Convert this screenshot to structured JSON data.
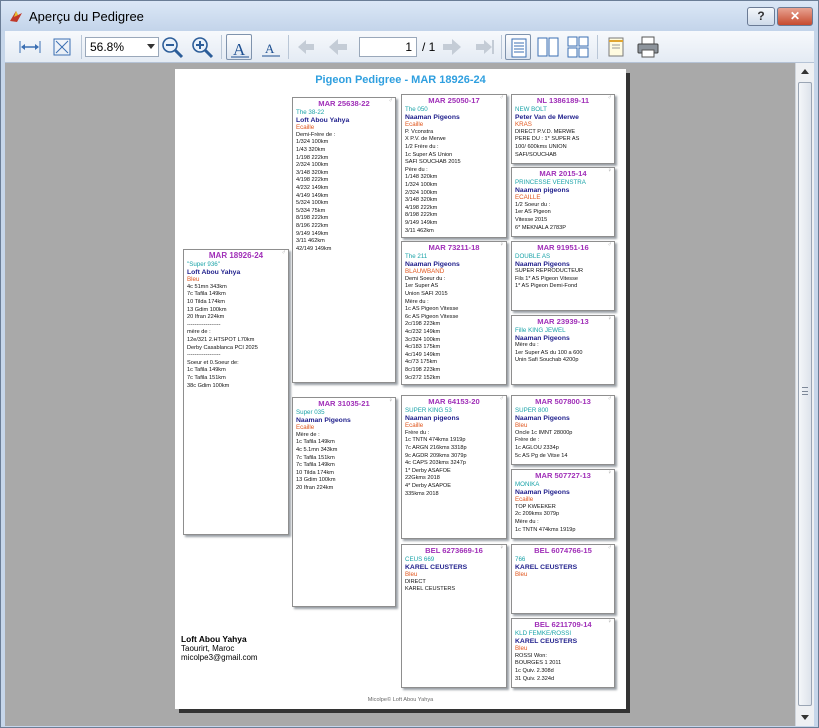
{
  "window": {
    "title": "Aperçu du Pedigree",
    "help_label": "?",
    "close_label": "✕"
  },
  "toolbar": {
    "zoom_value": "56.8%",
    "page_current": "1",
    "page_total": "/ 1",
    "icons": [
      "fit-width-icon",
      "fit-page-icon",
      "zoom-out-icon",
      "zoom-in-icon",
      "text-large-icon",
      "text-small-icon",
      "first-page-icon",
      "prev-page-icon",
      "next-page-icon",
      "last-page-icon",
      "single-page-icon",
      "two-page-icon",
      "four-page-icon",
      "page-setup-icon",
      "print-icon"
    ]
  },
  "pedigree": {
    "title": "Pigeon Pedigree - MAR 18926-24",
    "subject": {
      "ring": "MAR 18926-24",
      "sex": "♂",
      "name": "\"Super 936\"",
      "owner": "Loft Abou Yahya",
      "color": "Bleu",
      "lines": [
        "4c 51mn 343km",
        "7c Tafila 149km",
        "10 Tilda 174km",
        "13 Gdim 100km",
        "20 Ifran 224km",
        "------------------",
        "mère de :",
        "12e/321 2.HTSPOT L70km",
        "Derby Casablanca PCI 2025",
        "------------------",
        "Soeur et 0.Soeur de:",
        "1c Tafila 149km",
        "7c Tafila 151km",
        "38c Gdim 100km"
      ]
    },
    "gen1": [
      {
        "ring": "MAR 25638-22",
        "sex": "♂",
        "name": "The 38-22",
        "owner": "Loft Abou Yahya",
        "color": "Ecaille",
        "lines": [
          "Demi-Frère de :",
          "1/324 100km",
          "1/43 320km",
          "1/198 222km",
          "2/324 100km",
          "3/148 320km",
          "4/198 222km",
          "4/232 149km",
          "4/149 149km",
          "5/324 100km",
          "5/334 75km",
          "8/198 222km",
          "8/196 222km",
          "9/149 149km",
          "3/11 462km",
          "42/149 149km"
        ]
      },
      {
        "ring": "MAR 31035-21",
        "sex": "♀",
        "name": "Super 035",
        "owner": "Naaman Pigeons",
        "color": "Ecaille",
        "lines": [
          "Mère de :",
          "1c Tafila 149km",
          "4c 5.1mn 343km",
          "7c Tafila 151km",
          "7c Tafila 149km",
          "10 Tilda 174km",
          "13 Gdim 100km",
          "20 Ifran 224km"
        ]
      }
    ],
    "gen2": [
      {
        "ring": "MAR 25050-17",
        "sex": "♂",
        "name": "The 050",
        "owner": "Naaman Pigeons",
        "color": "Ecaille",
        "lines": [
          "P. Vconstra",
          "X P.V. de Merwe",
          "1/2 Frère du :",
          "1c Super AS Union",
          "SAFI SOUCHAB 2015",
          "Père du :",
          "1/148 320km",
          "1/324 100km",
          "2/324 100km",
          "3/148 320km",
          "4/198 222km",
          "8/198 222km",
          "9/149 149km",
          "3/11 462km"
        ]
      },
      {
        "ring": "MAR 73211-18",
        "sex": "♀",
        "name": "The 211",
        "owner": "Naaman Pigeons",
        "color": "BLAUWBAND",
        "lines": [
          "Demi Soeur du :",
          "1er Super AS",
          "Union SAFI 2015",
          "Mère du :",
          "1c AS Pigeon Vitesse",
          "6c AS Pigeon Vitesse",
          "2c/198 223km",
          "4c/232 149km",
          "3c/324 100km",
          "4c/183 175km",
          "4c/149 149km",
          "4c/73 175km",
          "8c/198 223km",
          "9c/272 152km"
        ]
      },
      {
        "ring": "MAR 64153-20",
        "sex": "♂",
        "name": "SUPER KING 53",
        "owner": "Naaman pigeons",
        "color": "Ecaille",
        "lines": [
          "Frère du :",
          "1c TNTN 474kms 1919p",
          "7c ARGN 216kms 3318p",
          "9c AGDR 209kms 3079p",
          "4c CAPS 203kms 3247p",
          "1* Derby ASAFOE",
          "22Gkms 2018",
          "4* Derby ASAPOE",
          "335kms 2018"
        ]
      },
      {
        "ring": "BEL 6273669-16",
        "sex": "♀",
        "name": "CEUS 669",
        "owner": "KAREL CEUSTERS",
        "color": "Bleu",
        "lines": [
          "DIRECT",
          "KAREL CEUSTERS"
        ]
      }
    ],
    "gen3": [
      {
        "ring": "NL 1386189-11",
        "sex": "♂",
        "name": "NEW BOLT",
        "owner": "Peter Van de Merwe",
        "color": "KRAS",
        "lines": [
          "DIRECT P.V.D. MERWE",
          "PERE DU : 1* SUPER AS",
          "100/ 600kms UNION",
          "SAFI/SOUCHAB"
        ]
      },
      {
        "ring": "MAR 2015-14",
        "sex": "♀",
        "name": "PRINCESSE VEENSTRA",
        "owner": "Naaman pigeons",
        "color": "ECAILLE",
        "lines": [
          "1/2 Soeur du :",
          "1er AS Pigeon",
          "Vitesse 2015",
          "6* MEKNALA 2783P"
        ]
      },
      {
        "ring": "MAR 91951-16",
        "sex": "♂",
        "name": "DOUBLE AS",
        "owner": "Naaman Pigeons",
        "color": "",
        "lines": [
          "SUPER REPRODUCTEUR",
          "Fils 1* AS Pigeon Vitesse",
          "1* AS Pigeon Demi-Fond"
        ]
      },
      {
        "ring": "MAR 23939-13",
        "sex": "♀",
        "name": "Fille KING JEWEL",
        "owner": "Naaman Pigeons",
        "color": "",
        "lines": [
          "Mère du :",
          "1er Super AS du 100 a 600",
          "Unin Safi Souchab 4200p"
        ]
      },
      {
        "ring": "MAR 507800-13",
        "sex": "♂",
        "name": "SUPER 800",
        "owner": "Naaman Pigeons",
        "color": "Bleu",
        "lines": [
          "Oncle 1c IMNT 28000p",
          "Frère de :",
          "1c AGLOU 2334p",
          "5c AS Pg de Vitse 14"
        ]
      },
      {
        "ring": "MAR 507727-13",
        "sex": "♀",
        "name": "MONIKA",
        "owner": "Naaman Pigeons",
        "color": "Ecaille",
        "lines": [
          "TOP KWEEKER",
          "2c 209kms 3079p",
          "Mère du :",
          "1c TNTN 474kms 1919p"
        ]
      },
      {
        "ring": "BEL 6074766-15",
        "sex": "♂",
        "name": "766",
        "owner": "KAREL CEUSTERS",
        "color": "Bleu",
        "lines": []
      },
      {
        "ring": "BEL 6211709-14",
        "sex": "♀",
        "name": "KLD FEMKE/ROSSI",
        "owner": "KAREL CEUSTERS",
        "color": "Bleu",
        "lines": [
          "ROSSI Won:",
          "BOURGES 1 2011",
          "1c Quiv. 2.308d",
          "31 Quiv. 2.324d"
        ]
      }
    ],
    "footer_owner": {
      "name": "Loft Abou Yahya",
      "city": "Taourirt, Maroc",
      "email": "micolpe3@gmail.com"
    },
    "page_footer": "Micolpe© Loft Abou Yahya"
  }
}
